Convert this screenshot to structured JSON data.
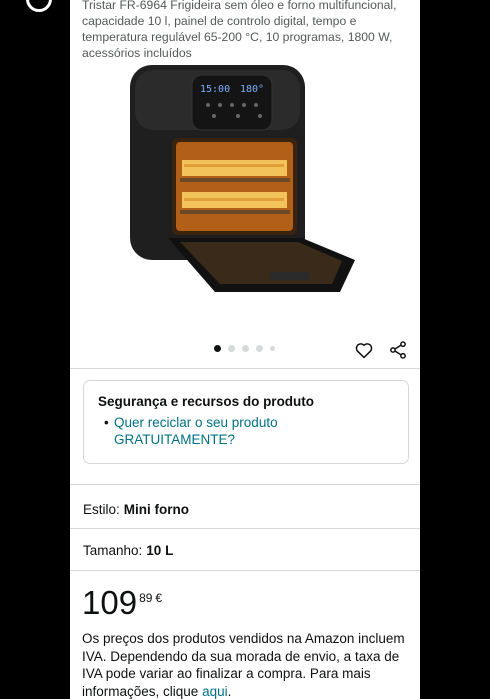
{
  "product": {
    "description": "Tristar FR-6964 Frigideira sem óleo e forno multifuncional, capacidade 10 l, painel de controlo digital, tempo e temperatura regulável 65-200 °C, 10 programas, 1800 W, acessórios incluídos",
    "display_time": "15:00",
    "display_temp": "180°"
  },
  "carousel": {
    "total": 5,
    "active_index": 0
  },
  "safety_card": {
    "title": "Segurança e recursos do produto",
    "bullet": "•",
    "link": "Quer reciclar o seu produto GRATUITAMENTE?"
  },
  "style": {
    "label": "Estilo:",
    "value": "Mini forno"
  },
  "size": {
    "label": "Tamanho:",
    "value": "10 L"
  },
  "price": {
    "whole": "109",
    "fraction": "89",
    "currency": "€"
  },
  "tax_note": {
    "text": "Os preços dos produtos vendidos na Amazon incluem IVA. Dependendo da sua morada de envio, a taxa de IVA pode variar ao finalizar a compra. Para mais informações, clique ",
    "link": "aqui",
    "end": "."
  },
  "icons": {
    "wishlist": "heart-icon",
    "share": "share-icon"
  }
}
